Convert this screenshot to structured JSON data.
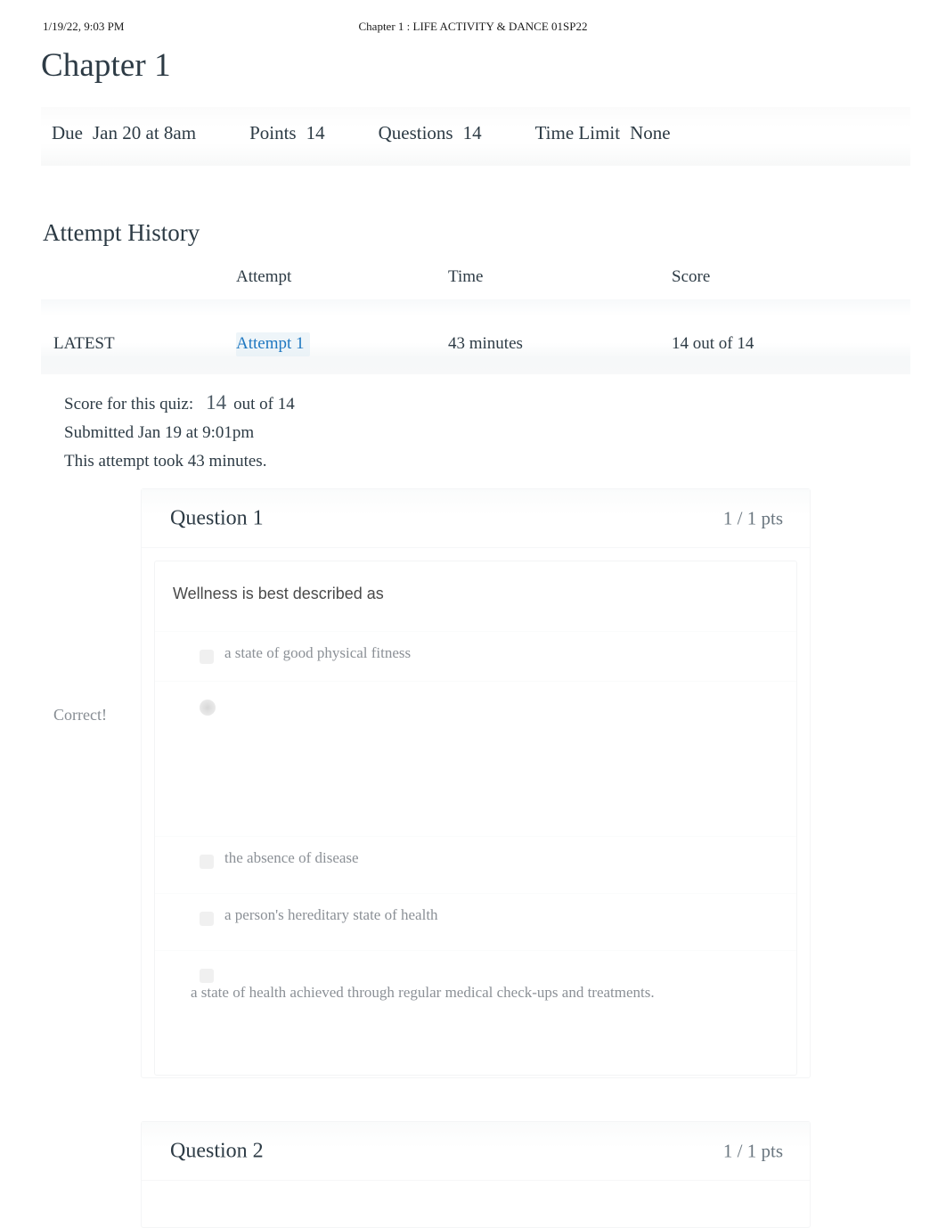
{
  "print_header": {
    "date": "1/19/22, 9:03 PM",
    "course_title": "Chapter 1 : LIFE ACTIVITY & DANCE 01SP22"
  },
  "page_title": "Chapter 1",
  "quiz_meta": {
    "due_label": "Due",
    "due_value": "Jan 20 at 8am",
    "points_label": "Points",
    "points_value": "14",
    "questions_label": "Questions",
    "questions_value": "14",
    "time_limit_label": "Time Limit",
    "time_limit_value": "None"
  },
  "attempt_history": {
    "heading": "Attempt History",
    "columns": [
      "",
      "Attempt",
      "Time",
      "Score"
    ],
    "rows": [
      {
        "kept": "LATEST",
        "attempt": "Attempt 1",
        "time": "43 minutes",
        "score": "14 out of 14"
      }
    ]
  },
  "score_summary": {
    "score_label": "Score for this quiz:",
    "score_value": "14",
    "score_out_of": "out of 14",
    "submitted": "Submitted Jan 19 at 9:01pm",
    "duration": "This attempt took 43 minutes."
  },
  "questions": [
    {
      "name": "Question 1",
      "points": "1 / 1 pts",
      "text": "Wellness is best described as",
      "correct_flag": "Correct!",
      "answers": [
        {
          "text": "a state of good physical fitness",
          "selected": false,
          "wrap": false
        },
        {
          "text": "",
          "selected": true,
          "wrap": false
        },
        {
          "text": "the absence of disease",
          "selected": false,
          "wrap": false
        },
        {
          "text": "a person's hereditary state of health",
          "selected": false,
          "wrap": false
        },
        {
          "text": "a state of health achieved through regular medical check-ups and treatments.",
          "selected": false,
          "wrap": true
        }
      ]
    },
    {
      "name": "Question 2",
      "points": "1 / 1 pts"
    }
  ],
  "colors": {
    "link": "#1f78c1",
    "text": "#2d3b45",
    "muted": "#8b9096"
  }
}
